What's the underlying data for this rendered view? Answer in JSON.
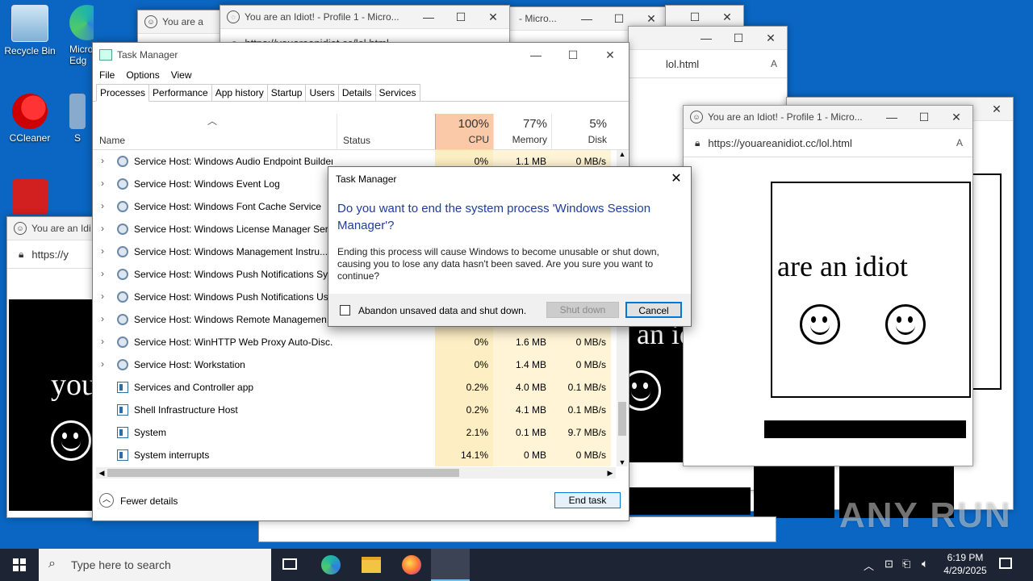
{
  "desktop": {
    "icons": [
      {
        "label": "Recycle Bin",
        "icon": "recycle-bin-icon"
      },
      {
        "label": "Micro Edg",
        "icon": "edge-icon"
      },
      {
        "label": "CCleaner",
        "icon": "ccleaner-icon"
      },
      {
        "label": "S",
        "icon": "shortcut-icon"
      },
      {
        "label": "",
        "icon": "acrobat-icon"
      }
    ]
  },
  "browser": {
    "title_main": "You are an Idiot! - Profile 1 - Micro...",
    "title_short": "You are a",
    "title_micro": "- Micro...",
    "title_left": "You are an Idi",
    "url": "https://youareanidiot.cc/lol.html",
    "url_short": "https://y",
    "url_tail": "lol.html",
    "idiot_text": "are an idiot",
    "idiot_text_b": "an idiot",
    "idiot_text_c": "you"
  },
  "taskmgr": {
    "title": "Task Manager",
    "menu": [
      "File",
      "Options",
      "View"
    ],
    "tabs": [
      "Processes",
      "Performance",
      "App history",
      "Startup",
      "Users",
      "Details",
      "Services"
    ],
    "columns": {
      "name": "Name",
      "status": "Status",
      "cpu_pct": "100%",
      "cpu": "CPU",
      "mem_pct": "77%",
      "mem": "Memory",
      "disk_pct": "5%",
      "disk": "Disk"
    },
    "rows": [
      {
        "name": "Service Host: Windows Audio Endpoint Builder",
        "cpu": "0%",
        "mem": "1.1 MB",
        "disk": "0 MB/s",
        "expand": true,
        "icon": "gear"
      },
      {
        "name": "Service Host: Windows Event Log",
        "cpu": "",
        "mem": "",
        "disk": "",
        "expand": true,
        "icon": "gear"
      },
      {
        "name": "Service Host: Windows Font Cache Service",
        "cpu": "",
        "mem": "",
        "disk": "",
        "expand": true,
        "icon": "gear"
      },
      {
        "name": "Service Host: Windows License Manager Serv...",
        "cpu": "",
        "mem": "",
        "disk": "",
        "expand": true,
        "icon": "gear"
      },
      {
        "name": "Service Host: Windows Management Instru...",
        "cpu": "",
        "mem": "",
        "disk": "",
        "expand": true,
        "icon": "gear"
      },
      {
        "name": "Service Host: Windows Push Notifications Sy...",
        "cpu": "",
        "mem": "",
        "disk": "",
        "expand": true,
        "icon": "gear"
      },
      {
        "name": "Service Host: Windows Push Notifications Us...",
        "cpu": "",
        "mem": "",
        "disk": "",
        "expand": true,
        "icon": "gear"
      },
      {
        "name": "Service Host: Windows Remote Managemen...",
        "cpu": "",
        "mem": "",
        "disk": "",
        "expand": true,
        "icon": "gear"
      },
      {
        "name": "Service Host: WinHTTP Web Proxy Auto-Disc...",
        "cpu": "0%",
        "mem": "1.6 MB",
        "disk": "0 MB/s",
        "expand": true,
        "icon": "gear"
      },
      {
        "name": "Service Host: Workstation",
        "cpu": "0%",
        "mem": "1.4 MB",
        "disk": "0 MB/s",
        "expand": true,
        "icon": "gear"
      },
      {
        "name": "Services and Controller app",
        "cpu": "0.2%",
        "mem": "4.0 MB",
        "disk": "0.1 MB/s",
        "expand": false,
        "icon": "app"
      },
      {
        "name": "Shell Infrastructure Host",
        "cpu": "0.2%",
        "mem": "4.1 MB",
        "disk": "0.1 MB/s",
        "expand": false,
        "icon": "app"
      },
      {
        "name": "System",
        "cpu": "2.1%",
        "mem": "0.1 MB",
        "disk": "9.7 MB/s",
        "expand": false,
        "icon": "app"
      },
      {
        "name": "System interrupts",
        "cpu": "14.1%",
        "mem": "0 MB",
        "disk": "0 MB/s",
        "expand": false,
        "icon": "app"
      }
    ],
    "fewer_details": "Fewer details",
    "end_task": "End task"
  },
  "dialog": {
    "title": "Task Manager",
    "question": "Do you want to end the system process 'Windows Session Manager'?",
    "body": "Ending this process will cause Windows to become unusable or shut down, causing you to lose any data hasn't been saved. Are you sure you want to continue?",
    "checkbox_label": "Abandon unsaved data and shut down.",
    "shutdown_label": "Shut down",
    "cancel_label": "Cancel"
  },
  "taskbar": {
    "search_placeholder": "Type here to search",
    "time": "6:19 PM",
    "date": "4/29/2025"
  },
  "watermark": "ANY RUN",
  "colors": {
    "desktop": "#0a66c2",
    "cpu_header": "#f9c9a8",
    "cpu_cell": "#fdeec4",
    "dialog_question": "#1f3d99",
    "taskbar": "#1d2433"
  }
}
